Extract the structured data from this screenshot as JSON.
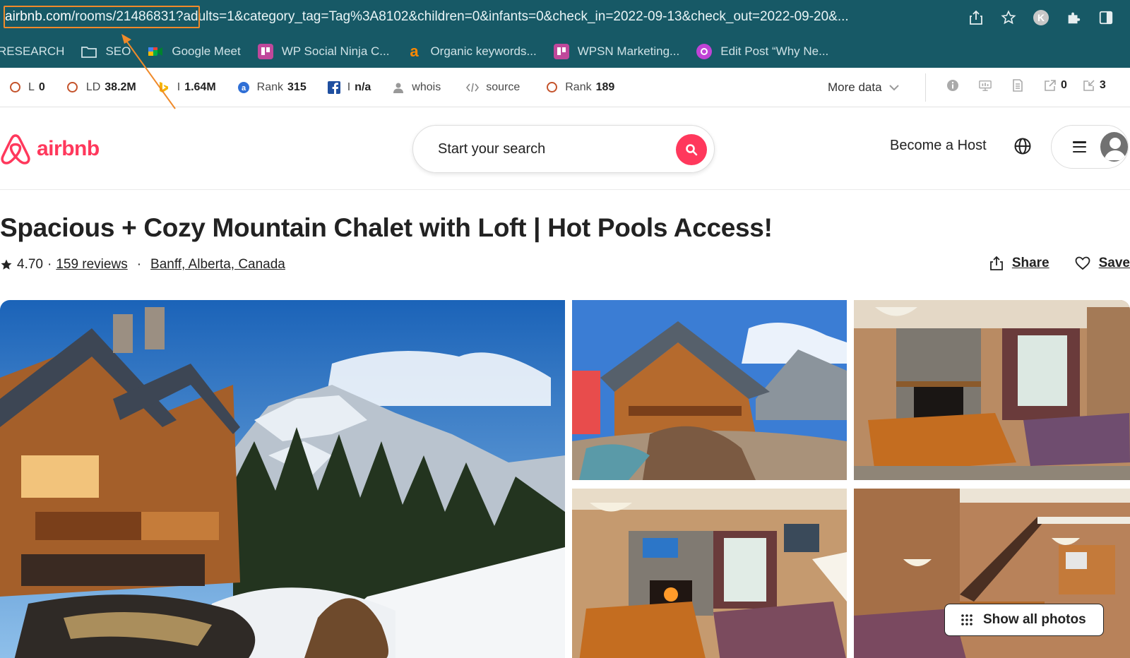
{
  "browser": {
    "url_host": "airbnb.com",
    "url_rest_highlighted": "/rooms/21486831",
    "url_tail": "?adults=1&category_tag=Tag%3A8102&children=0&infants=0&check_in=2022-09-13&check_out=2022-09-20&...",
    "profile_initial": "K",
    "icons": [
      "share-icon",
      "star-bookmark-icon",
      "profile-icon",
      "extensions-puzzle-icon",
      "sidebar-icon"
    ],
    "highlight_color": "#f08a2a",
    "chrome_color": "#175966"
  },
  "bookmarks": [
    {
      "label": "RESEARCH",
      "icon": "none"
    },
    {
      "label": "SEO",
      "icon": "folder-icon"
    },
    {
      "label": "Google Meet",
      "icon": "google-meet-icon"
    },
    {
      "label": "WP Social Ninja C...",
      "icon": "trello-icon"
    },
    {
      "label": "Organic keywords...",
      "icon": "ahrefs-a-icon"
    },
    {
      "label": "WPSN Marketing...",
      "icon": "trello-icon"
    },
    {
      "label": "Edit Post “Why Ne...",
      "icon": "wordpress-icon"
    }
  ],
  "ext_bar": {
    "metrics": [
      {
        "label": "L",
        "value": "0",
        "icon": "ring-icon"
      },
      {
        "label": "LD",
        "value": "38.2M",
        "icon": "ring-icon"
      },
      {
        "label": "I",
        "value": "1.64M",
        "icon": "bing-icon"
      },
      {
        "label": "Rank",
        "value": "315",
        "icon": "alexa-icon"
      },
      {
        "label": "I",
        "value": "n/a",
        "icon": "facebook-icon"
      },
      {
        "label": "whois",
        "value": "",
        "icon": "person-icon"
      },
      {
        "label": "source",
        "value": "",
        "icon": "code-icon"
      },
      {
        "label": "Rank",
        "value": "189",
        "icon": "ring-icon"
      }
    ],
    "more_data": "More data",
    "right_items": [
      {
        "icon": "info-icon",
        "value": ""
      },
      {
        "icon": "density-icon",
        "value": ""
      },
      {
        "icon": "page-icon",
        "value": ""
      },
      {
        "icon": "external-links-icon",
        "value": "0"
      },
      {
        "icon": "internal-links-icon",
        "value": "3"
      }
    ]
  },
  "airbnb": {
    "brand_color": "#ff385c",
    "logo_text": "airbnb",
    "search_placeholder": "Start your search",
    "become_host": "Become a Host"
  },
  "listing": {
    "title": "Spacious + Cozy Mountain Chalet with Loft | Hot Pools Access!",
    "rating": "4.70",
    "reviews": "159 reviews",
    "location": "Banff, Alberta, Canada",
    "share_label": "Share",
    "save_label": "Save",
    "show_all_photos": "Show all photos"
  }
}
